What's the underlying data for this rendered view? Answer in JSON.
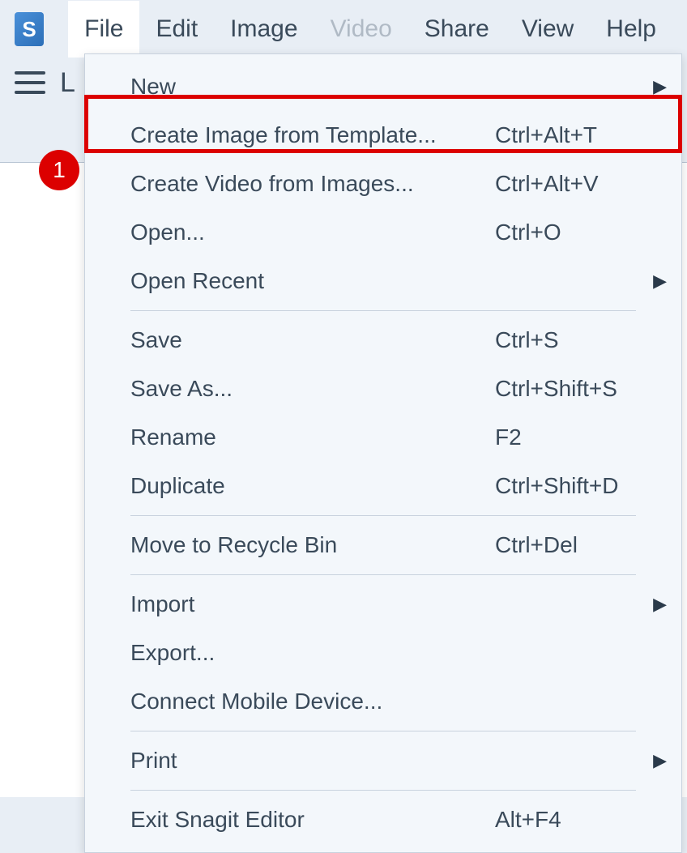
{
  "logo": {
    "text": "S"
  },
  "menubar": {
    "items": [
      {
        "label": "File",
        "active": true
      },
      {
        "label": "Edit"
      },
      {
        "label": "Image"
      },
      {
        "label": "Video",
        "disabled": true
      },
      {
        "label": "Share"
      },
      {
        "label": "View"
      },
      {
        "label": "Help"
      }
    ]
  },
  "toolbar": {
    "label": "L"
  },
  "dropdown": {
    "items": [
      {
        "label": "New",
        "shortcut": "",
        "submenu": true
      },
      {
        "label": "Create Image from Template...",
        "shortcut": "Ctrl+Alt+T",
        "highlighted": true
      },
      {
        "label": "Create Video from Images...",
        "shortcut": "Ctrl+Alt+V"
      },
      {
        "label": "Open...",
        "shortcut": "Ctrl+O"
      },
      {
        "label": "Open Recent",
        "shortcut": "",
        "submenu": true
      },
      {
        "sep": true
      },
      {
        "label": "Save",
        "shortcut": "Ctrl+S"
      },
      {
        "label": "Save As...",
        "shortcut": "Ctrl+Shift+S"
      },
      {
        "label": "Rename",
        "shortcut": "F2"
      },
      {
        "label": "Duplicate",
        "shortcut": "Ctrl+Shift+D"
      },
      {
        "sep": true
      },
      {
        "label": "Move to Recycle Bin",
        "shortcut": "Ctrl+Del"
      },
      {
        "sep": true
      },
      {
        "label": "Import",
        "shortcut": "",
        "submenu": true
      },
      {
        "label": "Export...",
        "shortcut": ""
      },
      {
        "label": "Connect Mobile Device...",
        "shortcut": ""
      },
      {
        "sep": true
      },
      {
        "label": "Print",
        "shortcut": "",
        "submenu": true
      },
      {
        "sep": true
      },
      {
        "label": "Exit Snagit Editor",
        "shortcut": "Alt+F4"
      }
    ]
  },
  "annotation": {
    "step": "1"
  }
}
